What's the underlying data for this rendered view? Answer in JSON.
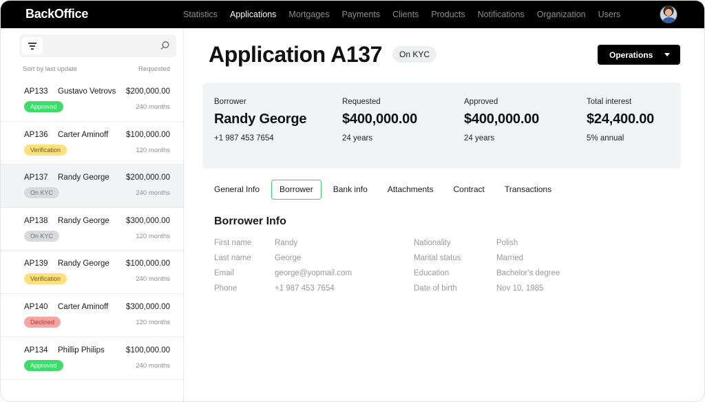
{
  "app": {
    "logo": "BackOffice"
  },
  "nav": [
    {
      "label": "Statistics",
      "active": false
    },
    {
      "label": "Applications",
      "active": true
    },
    {
      "label": "Mortgages",
      "active": false
    },
    {
      "label": "Payments",
      "active": false
    },
    {
      "label": "Clients",
      "active": false
    },
    {
      "label": "Products",
      "active": false
    },
    {
      "label": "Notifications",
      "active": false
    },
    {
      "label": "Organization",
      "active": false
    },
    {
      "label": "Users",
      "active": false
    }
  ],
  "sidebar": {
    "search": {
      "value": "",
      "placeholder": ""
    },
    "sort_label": "Sort by last update",
    "requested_label": "Requested",
    "items": [
      {
        "id": "AP133",
        "name": "Gustavo Vetrovs",
        "amount": "$200,000.00",
        "term": "240 months",
        "status": "Approved",
        "status_bg": "#3ddc6b",
        "status_fg": "#ffffff",
        "selected": false
      },
      {
        "id": "AP136",
        "name": "Carter Aminoff",
        "amount": "$100,000.00",
        "term": "120 months",
        "status": "Verification",
        "status_bg": "#ffe07a",
        "status_fg": "#6b5a1a",
        "selected": false
      },
      {
        "id": "AP137",
        "name": "Randy George",
        "amount": "$200,000.00",
        "term": "240 months",
        "status": "On KYC",
        "status_bg": "#d9dadd",
        "status_fg": "#6d6f73",
        "selected": true
      },
      {
        "id": "AP138",
        "name": "Randy George",
        "amount": "$300,000.00",
        "term": "120 months",
        "status": "On KYC",
        "status_bg": "#d9dadd",
        "status_fg": "#6d6f73",
        "selected": false
      },
      {
        "id": "AP139",
        "name": "Randy George",
        "amount": "$100,000.00",
        "term": "240 months",
        "status": "Verification",
        "status_bg": "#ffe07a",
        "status_fg": "#6b5a1a",
        "selected": false
      },
      {
        "id": "AP140",
        "name": "Carter Aminoff",
        "amount": "$300,000.00",
        "term": "120 months",
        "status": "Declined",
        "status_bg": "#f5a3a3",
        "status_fg": "#b23a3a",
        "selected": false
      },
      {
        "id": "AP134",
        "name": "Phillip Philips",
        "amount": "$100,000.00",
        "term": "240 months",
        "status": "Approved",
        "status_bg": "#3ddc6b",
        "status_fg": "#ffffff",
        "selected": false
      }
    ]
  },
  "main": {
    "title": "Application A137",
    "status": "On KYC",
    "operations_label": "Operations",
    "summary": [
      {
        "label": "Borrower",
        "value": "Randy George",
        "sub": "+1 987 453 7654"
      },
      {
        "label": "Requested",
        "value": "$400,000.00",
        "sub": "24 years"
      },
      {
        "label": "Approved",
        "value": "$400,000.00",
        "sub": "24 years"
      },
      {
        "label": "Total interest",
        "value": "$24,400.00",
        "sub": "5% annual"
      }
    ],
    "tabs": [
      {
        "label": "General Info",
        "active": false
      },
      {
        "label": "Borrower",
        "active": true
      },
      {
        "label": "Bank info",
        "active": false
      },
      {
        "label": "Attachments",
        "active": false
      },
      {
        "label": "Contract",
        "active": false
      },
      {
        "label": "Transactions",
        "active": false
      }
    ],
    "section_title": "Borrower Info",
    "info_rows": [
      {
        "k1": "First name",
        "v1": "Randy",
        "k2": "Nationality",
        "v2": "Polish"
      },
      {
        "k1": "Last name",
        "v1": "George",
        "k2": "Marital status",
        "v2": "Married"
      },
      {
        "k1": "Email",
        "v1": "george@yopmail.com",
        "k2": "Education",
        "v2": "Bachelor's degree"
      },
      {
        "k1": "Phone",
        "v1": "+1 987 453 7654",
        "k2": "Date of birth",
        "v2": "Nov 10, 1985"
      }
    ]
  }
}
